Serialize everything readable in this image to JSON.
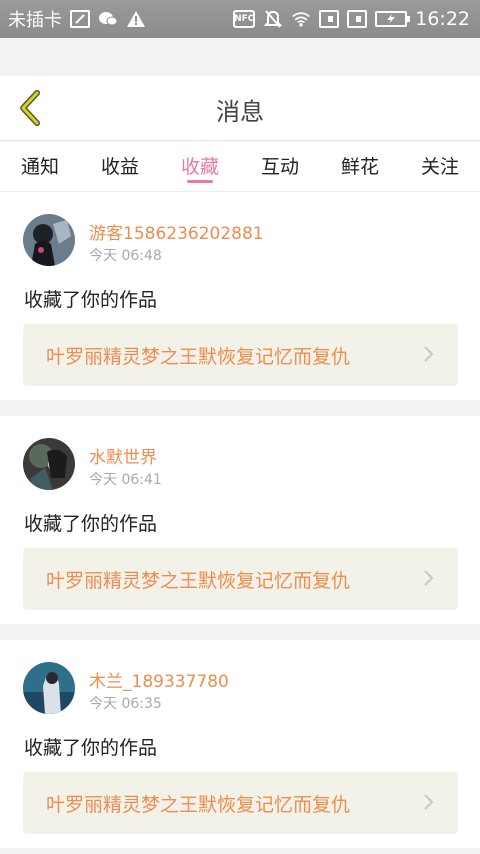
{
  "status_bar": {
    "carrier": "未插卡",
    "time": "16:22",
    "left_icons": [
      "sim-icon",
      "wechat-icon",
      "warning-icon"
    ],
    "right_icons": [
      "nfc-icon",
      "mute-icon",
      "wifi-icon",
      "sim-card-icon",
      "sim-card-icon",
      "battery-charging-icon"
    ],
    "nfc_label": "NFC"
  },
  "header": {
    "title": "消息",
    "back_icon": "back-chevron-icon",
    "accent_color": "#c9c624"
  },
  "tabs": [
    {
      "label": "通知",
      "active": false
    },
    {
      "label": "收益",
      "active": false
    },
    {
      "label": "收藏",
      "active": true
    },
    {
      "label": "互动",
      "active": false
    },
    {
      "label": "鲜花",
      "active": false
    },
    {
      "label": "关注",
      "active": false
    }
  ],
  "colors": {
    "active_tab": "#e87ba6",
    "username": "#ef8c4f",
    "work_title": "#ef8c4f",
    "work_bg": "#f3f2e8"
  },
  "messages": [
    {
      "username": "游客1586236202881",
      "time": "今天 06:48",
      "action": "收藏了你的作品",
      "work_title": "叶罗丽精灵梦之王默恢复记忆而复仇"
    },
    {
      "username": "水默世界",
      "time": "今天 06:41",
      "action": "收藏了你的作品",
      "work_title": "叶罗丽精灵梦之王默恢复记忆而复仇"
    },
    {
      "username": "木兰_189337780",
      "time": "今天 06:35",
      "action": "收藏了你的作品",
      "work_title": "叶罗丽精灵梦之王默恢复记忆而复仇"
    }
  ]
}
